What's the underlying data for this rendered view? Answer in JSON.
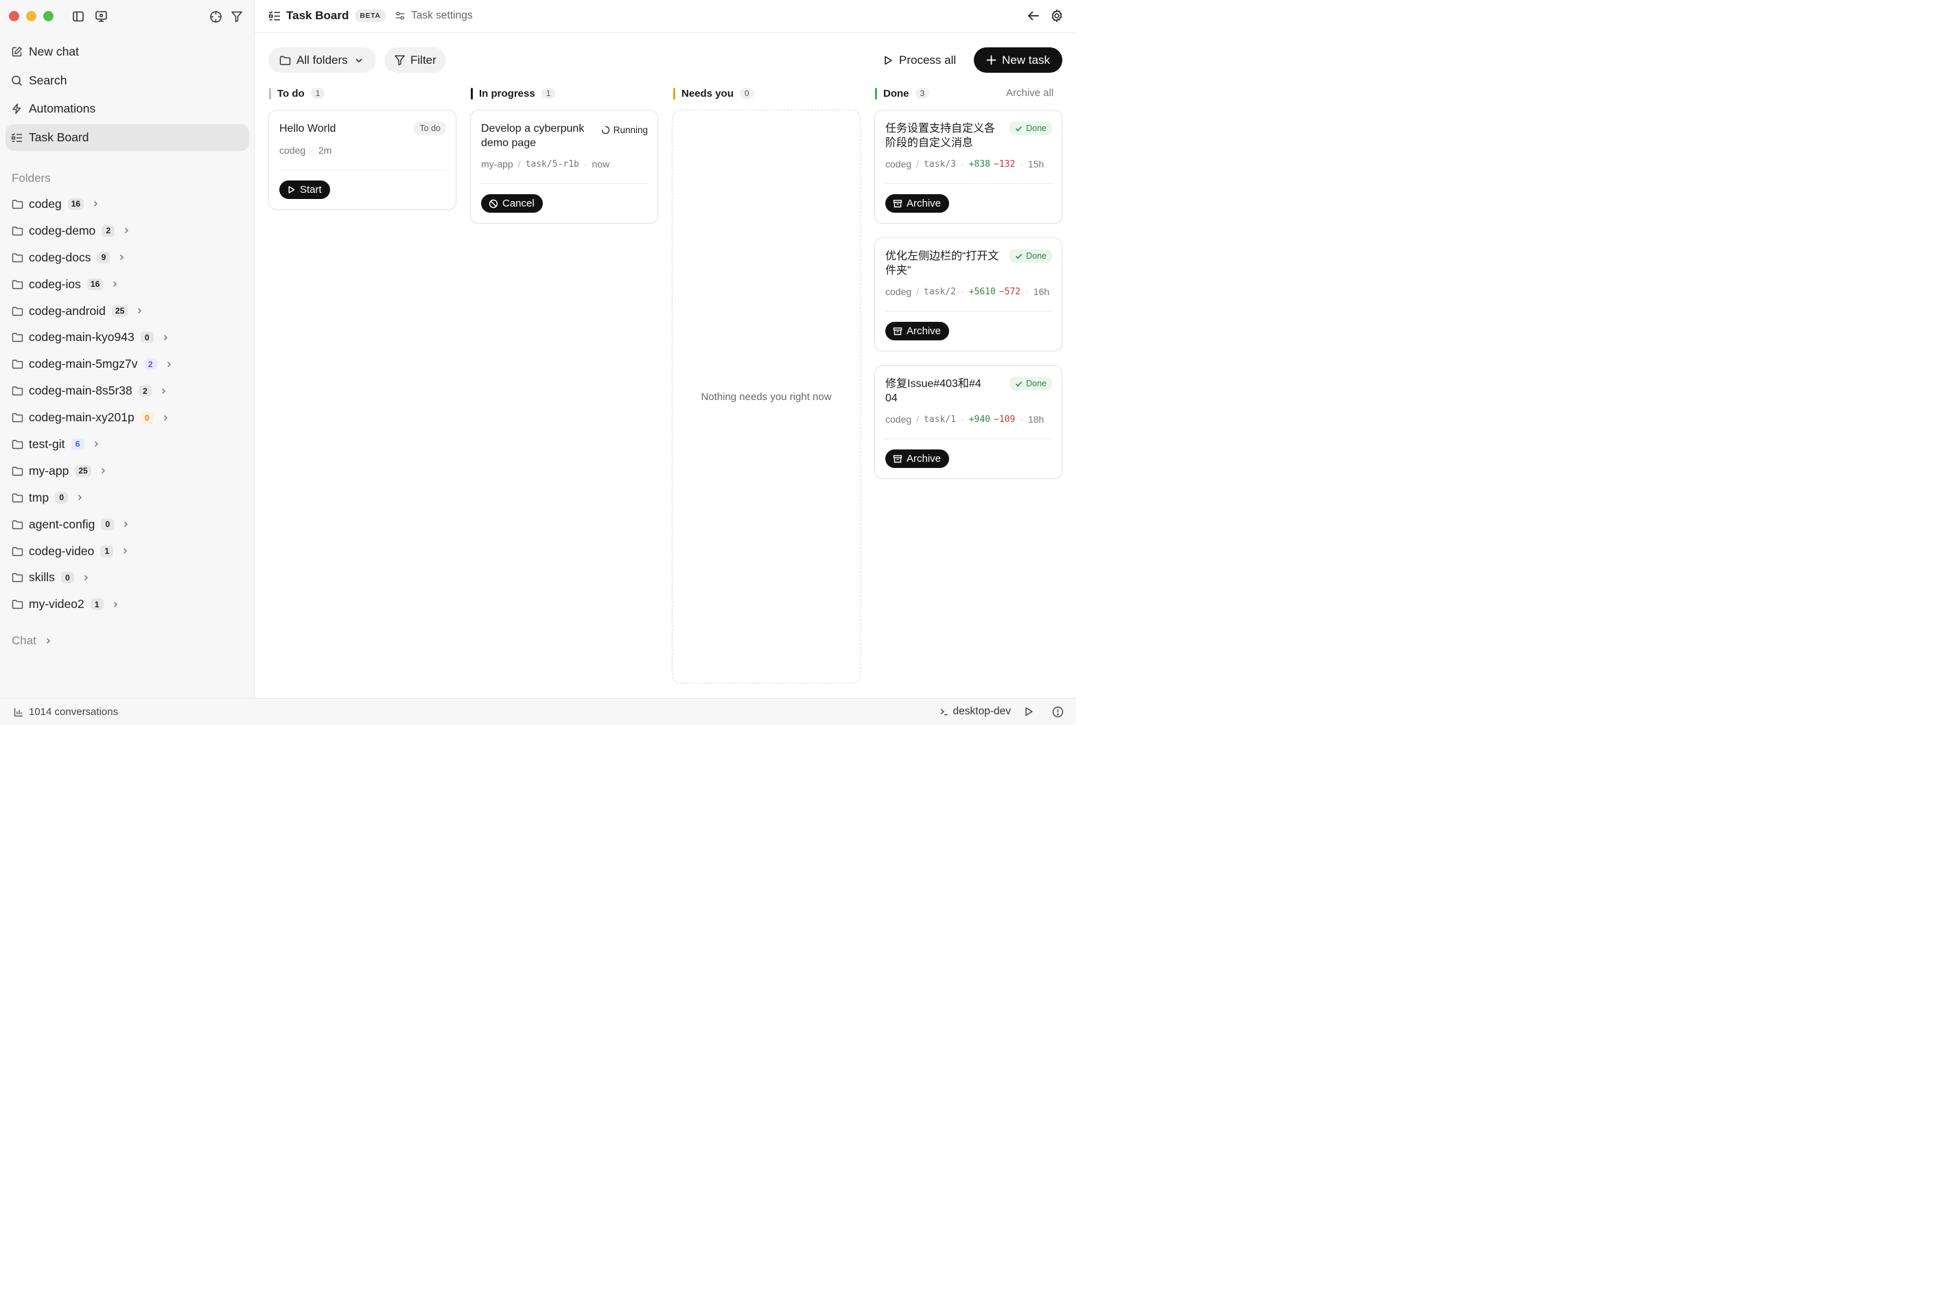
{
  "window": {
    "traffic_colors": [
      "#ee5d53",
      "#f2b838",
      "#50c045"
    ]
  },
  "sidebar": {
    "nav": [
      {
        "label": "New chat",
        "icon": "edit-icon"
      },
      {
        "label": "Search",
        "icon": "search-icon"
      },
      {
        "label": "Automations",
        "icon": "bolt-icon"
      },
      {
        "label": "Task Board",
        "icon": "checklist-icon",
        "active": true
      }
    ],
    "folders_label": "Folders",
    "folders": [
      {
        "name": "codeg",
        "count": "16"
      },
      {
        "name": "codeg-demo",
        "count": "2"
      },
      {
        "name": "codeg-docs",
        "count": "9"
      },
      {
        "name": "codeg-ios",
        "count": "16"
      },
      {
        "name": "codeg-android",
        "count": "25"
      },
      {
        "name": "codeg-main-kyo943",
        "count": "0"
      },
      {
        "name": "codeg-main-5mgz7v",
        "count": "2",
        "badge": "purple"
      },
      {
        "name": "codeg-main-8s5r38",
        "count": "2"
      },
      {
        "name": "codeg-main-xy201p",
        "count": "0",
        "badge": "orange"
      },
      {
        "name": "test-git",
        "count": "6",
        "badge": "blue"
      },
      {
        "name": "my-app",
        "count": "25"
      },
      {
        "name": "tmp",
        "count": "0"
      },
      {
        "name": "agent-config",
        "count": "0"
      },
      {
        "name": "codeg-video",
        "count": "1"
      },
      {
        "name": "skills",
        "count": "0"
      },
      {
        "name": "my-video2",
        "count": "1"
      }
    ],
    "chat_label": "Chat"
  },
  "header": {
    "title": "Task Board",
    "beta": "BETA",
    "settings": "Task settings"
  },
  "toolbar": {
    "all_folders": "All folders",
    "filter": "Filter",
    "process_all": "Process all",
    "new_task": "New task"
  },
  "columns": {
    "todo": {
      "title": "To do",
      "count": "1",
      "color": "#bdbdbd"
    },
    "progress": {
      "title": "In progress",
      "count": "1",
      "color": "#1a1a1a"
    },
    "needs": {
      "title": "Needs you",
      "count": "0",
      "color": "#f0a020",
      "empty": "Nothing needs you right now"
    },
    "done": {
      "title": "Done",
      "count": "3",
      "color": "#3cb45a",
      "archive_all": "Archive all"
    }
  },
  "cards": {
    "hello": {
      "title": "Hello World",
      "tag": "To do",
      "folder": "codeg",
      "time": "2m",
      "button": "Start"
    },
    "cyber": {
      "title": "Develop a cyberpunk demo page",
      "status": "Running",
      "folder": "my-app",
      "branch": "task/5-r1b",
      "time": "now",
      "button": "Cancel"
    },
    "done1": {
      "title": "任务设置支持自定义各阶段的自定义消息",
      "tag": "Done",
      "folder": "codeg",
      "branch": "task/3",
      "add": "+838",
      "del": "−132",
      "time": "15h",
      "button": "Archive"
    },
    "done2": {
      "title": "优化左侧边栏的“打开文件夹”",
      "tag": "Done",
      "folder": "codeg",
      "branch": "task/2",
      "add": "+5610",
      "del": "−572",
      "time": "16h",
      "button": "Archive"
    },
    "done3": {
      "title": "修复Issue#403和#404",
      "tag": "Done",
      "folder": "codeg",
      "branch": "task/1",
      "add": "+940",
      "del": "−109",
      "time": "18h",
      "button": "Archive"
    }
  },
  "footer": {
    "conversations": "1014 conversations",
    "env": "desktop-dev"
  }
}
